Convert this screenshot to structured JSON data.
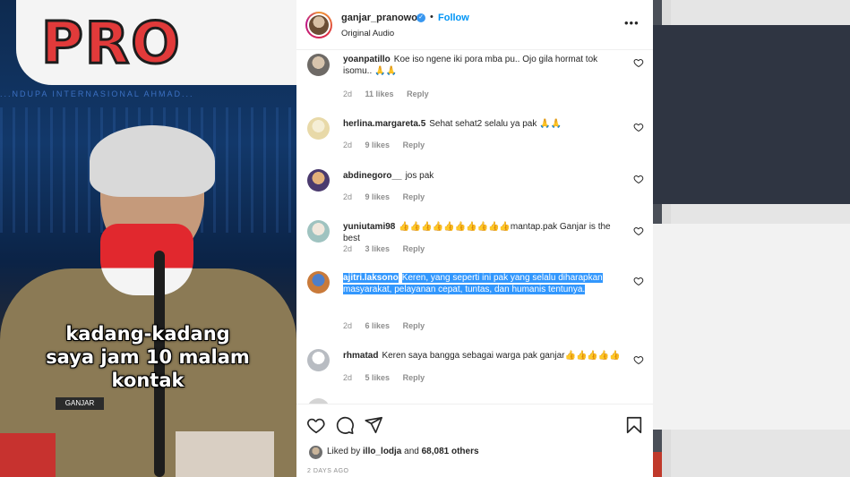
{
  "video": {
    "banner_text": "PRO",
    "band_text": "...NDUPA INTERNASIONAL AHMAD...",
    "caption_line1": "kadang-kadang",
    "caption_line2": "saya jam 10 malam",
    "caption_line3": "kontak",
    "nameplate": "GANJAR"
  },
  "header": {
    "username": "ganjar_pranowo",
    "follow_label": "Follow",
    "audio": "Original Audio",
    "more_label": "•••"
  },
  "comments": [
    {
      "user": "yoanpatillo",
      "text": "Koe iso ngene iki pora mba pu.. Ojo gila hormat tok isomu.. 🙏🙏",
      "age": "2d",
      "likes": "11 likes",
      "reply": "Reply",
      "avatar_color": "#6e6a66"
    },
    {
      "user": "herlina.margareta.5",
      "text": "Sehat sehat2 selalu ya pak 🙏🙏",
      "age": "2d",
      "likes": "9 likes",
      "reply": "Reply",
      "avatar_color": "#e8d9a8"
    },
    {
      "user": "abdinegoro__",
      "text": "jos pak",
      "age": "2d",
      "likes": "9 likes",
      "reply": "Reply",
      "avatar_color": "#4a3a6e"
    },
    {
      "user": "yuniutami98",
      "text": "👍👍👍👍👍👍👍👍👍👍mantap.pak Ganjar is the best",
      "age": "2d",
      "likes": "3 likes",
      "reply": "Reply",
      "avatar_color": "#9fc3c0"
    },
    {
      "user": "ajitri.laksono",
      "text": "Keren, yang seperti ini pak yang selalu diharapkan masyarakat, pelayanan cepat, tuntas, dan humanis tentunya.",
      "age": "2d",
      "likes": "6 likes",
      "reply": "Reply",
      "avatar_color": "#c97a3a"
    },
    {
      "user": "rhmatad",
      "text": "Keren saya bangga sebagai warga pak ganjar👍👍👍👍👍",
      "age": "2d",
      "likes": "5 likes",
      "reply": "Reply",
      "avatar_color": "#b8bcc2"
    }
  ],
  "footer": {
    "liked_prefix": "Liked by",
    "liked_user": "illo_lodja",
    "liked_mid": "and",
    "liked_count": "68,081 others",
    "date": "2 DAYS AGO"
  },
  "colors": {
    "accent": "#0095f6",
    "selection": "#3297fd",
    "text": "#262626",
    "muted": "#8e8e8e"
  },
  "icons": [
    "heart-icon",
    "comment-icon",
    "share-icon",
    "bookmark-icon",
    "verified-icon",
    "more-icon"
  ]
}
